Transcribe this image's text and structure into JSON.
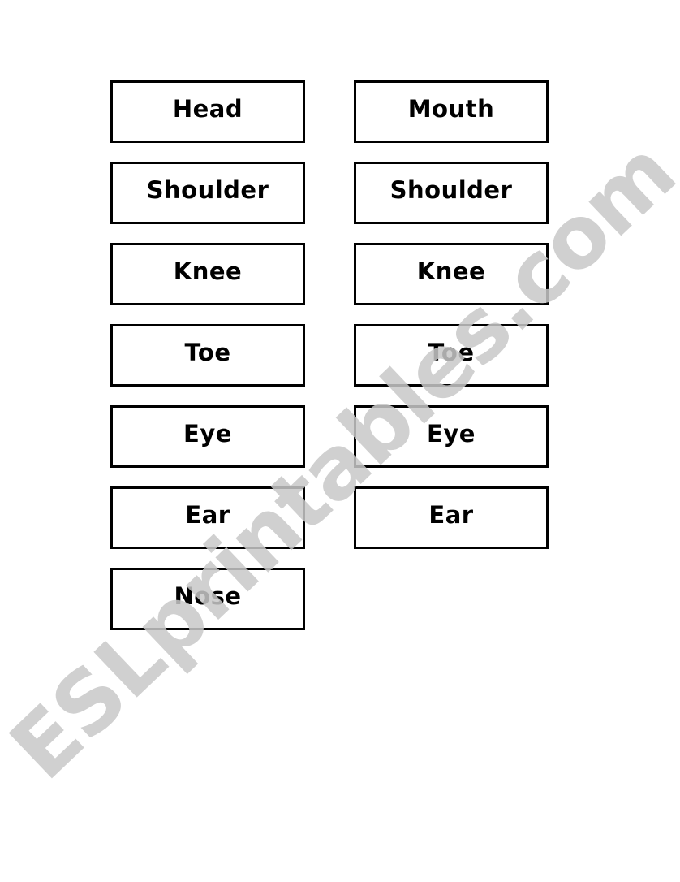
{
  "worksheet": {
    "left_column": [
      "Head",
      "Shoulder",
      "Knee",
      "Toe",
      "Eye",
      "Ear",
      "Nose"
    ],
    "right_column": [
      "Mouth",
      "Shoulder",
      "Knee",
      "Toe",
      "Eye",
      "Ear"
    ]
  },
  "watermark": {
    "text": "ESLprintables.com",
    "color": "#c8c8c8"
  }
}
